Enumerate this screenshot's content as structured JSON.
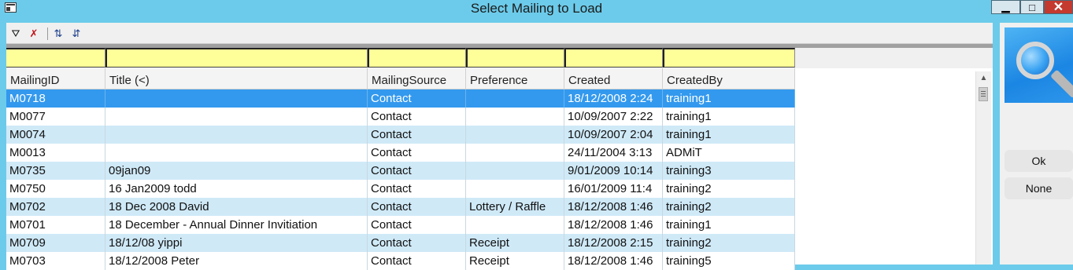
{
  "window": {
    "title": "Select Mailing to Load",
    "controls": {
      "minimize": "▁",
      "maximize": "□",
      "close": "✕"
    }
  },
  "toolbar": {
    "icons": [
      "filter-icon",
      "clear-filter-icon",
      "sort-ascending-icon",
      "sort-descending-icon"
    ],
    "glyphs": {
      "filter": "⛛",
      "clear_filter": "✗",
      "sort_asc": "⇅",
      "sort_desc": "⇵"
    }
  },
  "columns": [
    "MailingID",
    "Title (<)",
    "MailingSource",
    "Preference",
    "Created",
    "CreatedBy"
  ],
  "rows": [
    {
      "id": "M0718",
      "title": "",
      "source": "Contact",
      "preference": "",
      "created": "18/12/2008 2:24",
      "created_by": "training1",
      "selected": true
    },
    {
      "id": "M0077",
      "title": "",
      "source": "Contact",
      "preference": "",
      "created": "10/09/2007 2:22",
      "created_by": "training1"
    },
    {
      "id": "M0074",
      "title": "",
      "source": "Contact",
      "preference": "",
      "created": "10/09/2007 2:04",
      "created_by": "training1"
    },
    {
      "id": "M0013",
      "title": "",
      "source": "Contact",
      "preference": "",
      "created": "24/11/2004 3:13",
      "created_by": "ADMiT"
    },
    {
      "id": "M0735",
      "title": "09jan09",
      "source": "Contact",
      "preference": "",
      "created": "9/01/2009 10:14",
      "created_by": "training3"
    },
    {
      "id": "M0750",
      "title": "16 Jan2009 todd",
      "source": "Contact",
      "preference": "",
      "created": "16/01/2009 11:4",
      "created_by": "training2"
    },
    {
      "id": "M0702",
      "title": "18 Dec 2008 David",
      "source": "Contact",
      "preference": "Lottery / Raffle",
      "created": "18/12/2008 1:46",
      "created_by": "training2"
    },
    {
      "id": "M0701",
      "title": "18 December - Annual Dinner Invitiation",
      "source": "Contact",
      "preference": "",
      "created": "18/12/2008 1:46",
      "created_by": "training1"
    },
    {
      "id": "M0709",
      "title": "18/12/08 yippi",
      "source": "Contact",
      "preference": "Receipt",
      "created": "18/12/2008 2:15",
      "created_by": "training2"
    },
    {
      "id": "M0703",
      "title": "18/12/2008 Peter",
      "source": "Contact",
      "preference": "Receipt",
      "created": "18/12/2008 1:46",
      "created_by": "training5"
    }
  ],
  "buttons": {
    "ok": "Ok",
    "none": "None"
  },
  "colors": {
    "titlebar": "#6ccbea",
    "filter_row": "#ffff99",
    "row_alt": "#cfe9f7",
    "row_selected": "#3399ee"
  }
}
